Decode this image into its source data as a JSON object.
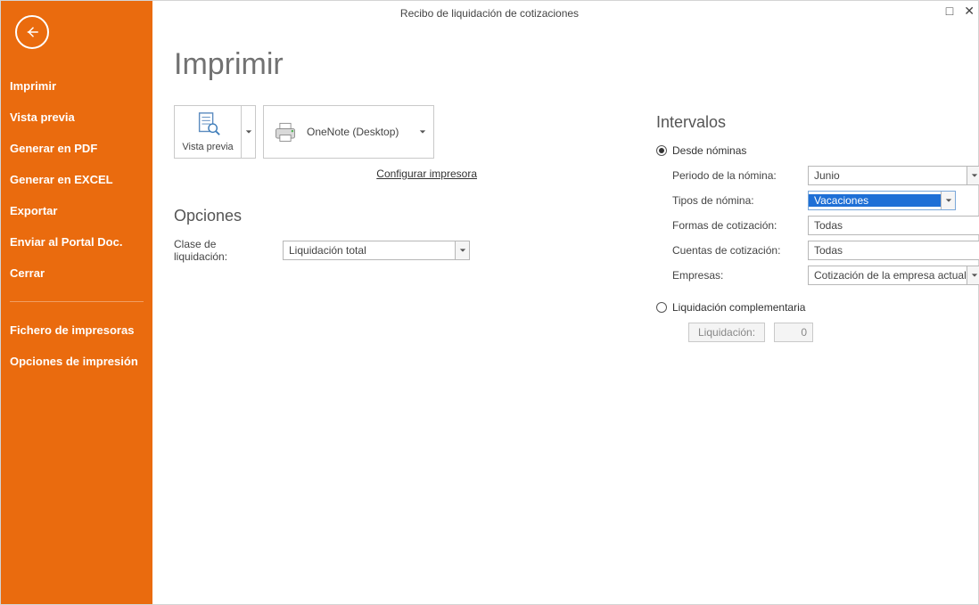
{
  "window": {
    "title": "Recibo de liquidación de cotizaciones"
  },
  "sidebar": {
    "items": [
      "Imprimir",
      "Vista previa",
      "Generar en PDF",
      "Generar en EXCEL",
      "Exportar",
      "Enviar al Portal Doc.",
      "Cerrar"
    ],
    "items2": [
      "Fichero de impresoras",
      "Opciones de impresión"
    ]
  },
  "main": {
    "heading": "Imprimir",
    "preview_label": "Vista previa",
    "printer_name": "OneNote (Desktop)",
    "config_link": "Configurar impresora",
    "opciones_title": "Opciones",
    "clase_label": "Clase de liquidación:",
    "clase_value": "Liquidación total"
  },
  "right": {
    "title": "Intervalos",
    "radio1": "Desde nóminas",
    "rows": {
      "periodo_label": "Periodo de la nómina:",
      "periodo_value": "Junio",
      "tipos_label": "Tipos de nómina:",
      "tipos_value": "Vacaciones",
      "formas_label": "Formas de cotización:",
      "formas_value": "Todas",
      "cuentas_label": "Cuentas de cotización:",
      "cuentas_value": "Todas",
      "empresas_label": "Empresas:",
      "empresas_value": "Cotización de la empresa actual"
    },
    "radio2": "Liquidación complementaria",
    "liq_label": "Liquidación:",
    "liq_value": "0"
  }
}
